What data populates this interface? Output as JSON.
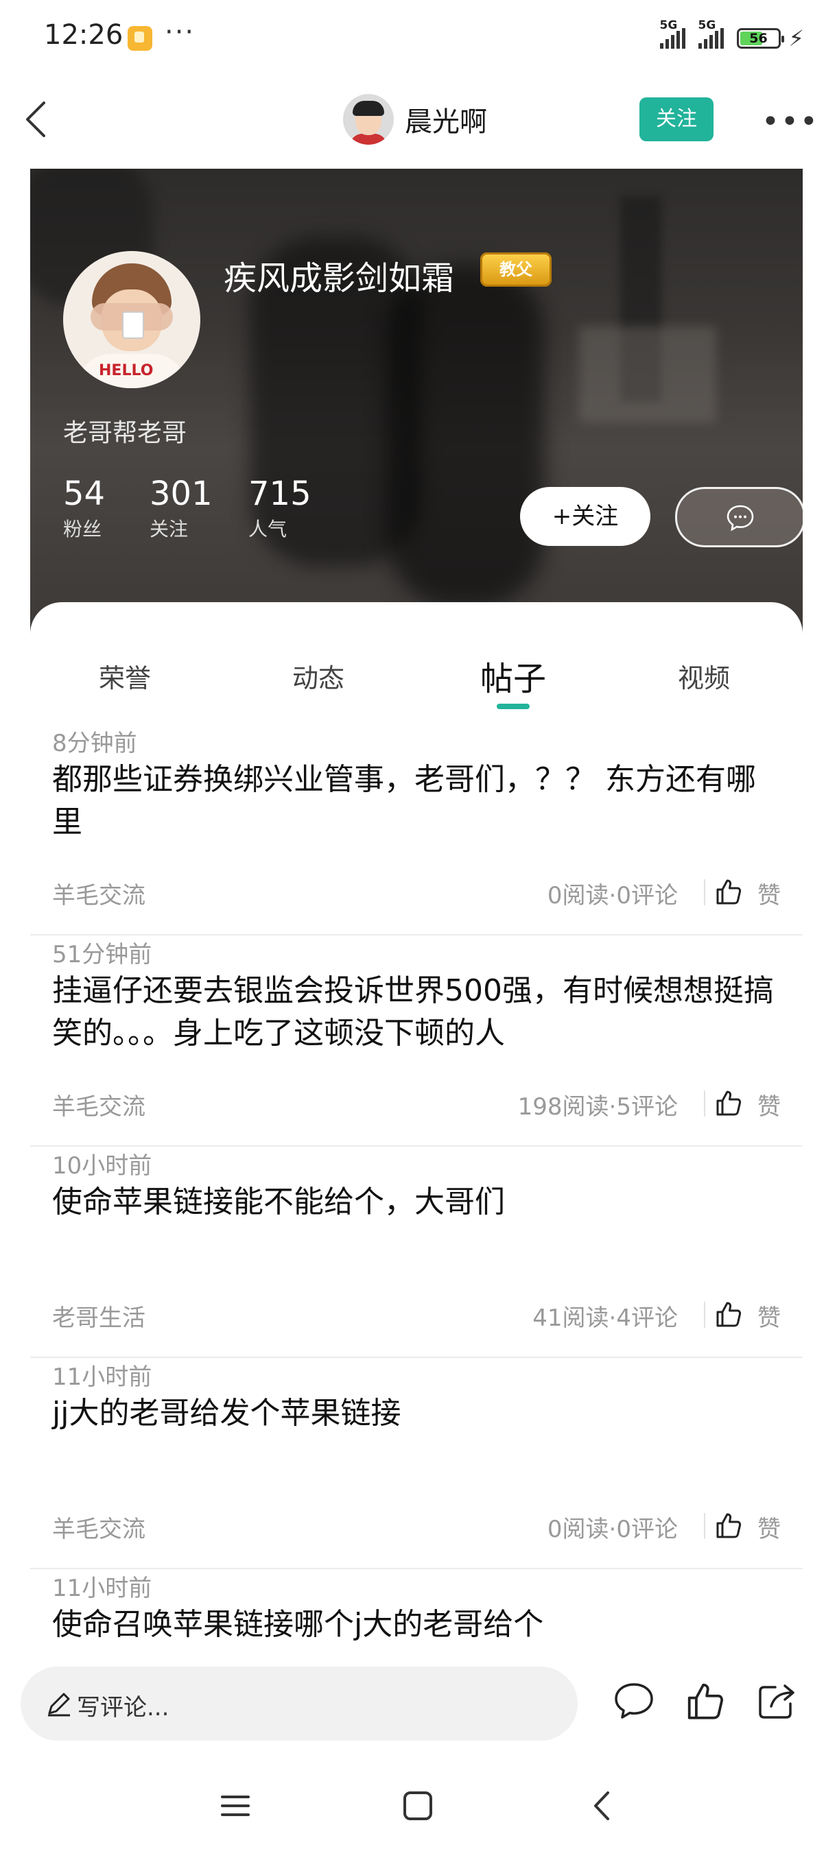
{
  "status_bar": {
    "time": "12:26",
    "more": "···",
    "signal1_label": "5G",
    "signal2_label": "5G",
    "battery": "56",
    "battery_level": 0.56
  },
  "nav": {
    "username": "晨光啊",
    "follow_label": "关注",
    "more": "•••"
  },
  "profile": {
    "name": "疾风成影剑如霜",
    "badge": "教父",
    "signature": "老哥帮老哥",
    "stats": [
      {
        "num": "54",
        "label": "粉丝"
      },
      {
        "num": "301",
        "label": "关注"
      },
      {
        "num": "715",
        "label": "人气"
      }
    ],
    "follow_button": "+关注",
    "avatar_text": "HELLO"
  },
  "tabs": [
    {
      "label": "荣誉"
    },
    {
      "label": "动态"
    },
    {
      "label": "帖子"
    },
    {
      "label": "视频"
    }
  ],
  "active_tab": "帖子",
  "posts": [
    {
      "time": "8分钟前",
      "title": "都那些证券换绑兴业管事，老哥们，？？ 东方还有哪里",
      "category": "羊毛交流",
      "stats": "0阅读·0评论",
      "like": "赞"
    },
    {
      "time": "51分钟前",
      "title": "挂逼仔还要去银监会投诉世界500强，有时候想想挺搞笑的。。。身上吃了这顿没下顿的人",
      "category": "羊毛交流",
      "stats": "198阅读·5评论",
      "like": "赞"
    },
    {
      "time": "10小时前",
      "title": "使命苹果链接能不能给个，大哥们",
      "category": "老哥生活",
      "stats": "41阅读·4评论",
      "like": "赞"
    },
    {
      "time": "11小时前",
      "title": "jj大的老哥给发个苹果链接",
      "category": "羊毛交流",
      "stats": "0阅读·0评论",
      "like": "赞"
    },
    {
      "time": "11小时前",
      "title": "使命召唤苹果链接哪个j大的老哥给个",
      "category": "",
      "stats": "",
      "like": ""
    }
  ],
  "comment_bar": {
    "placeholder": "写评论..."
  },
  "colors": {
    "accent": "#22b39b",
    "badge_gold": "#e8a81c"
  }
}
